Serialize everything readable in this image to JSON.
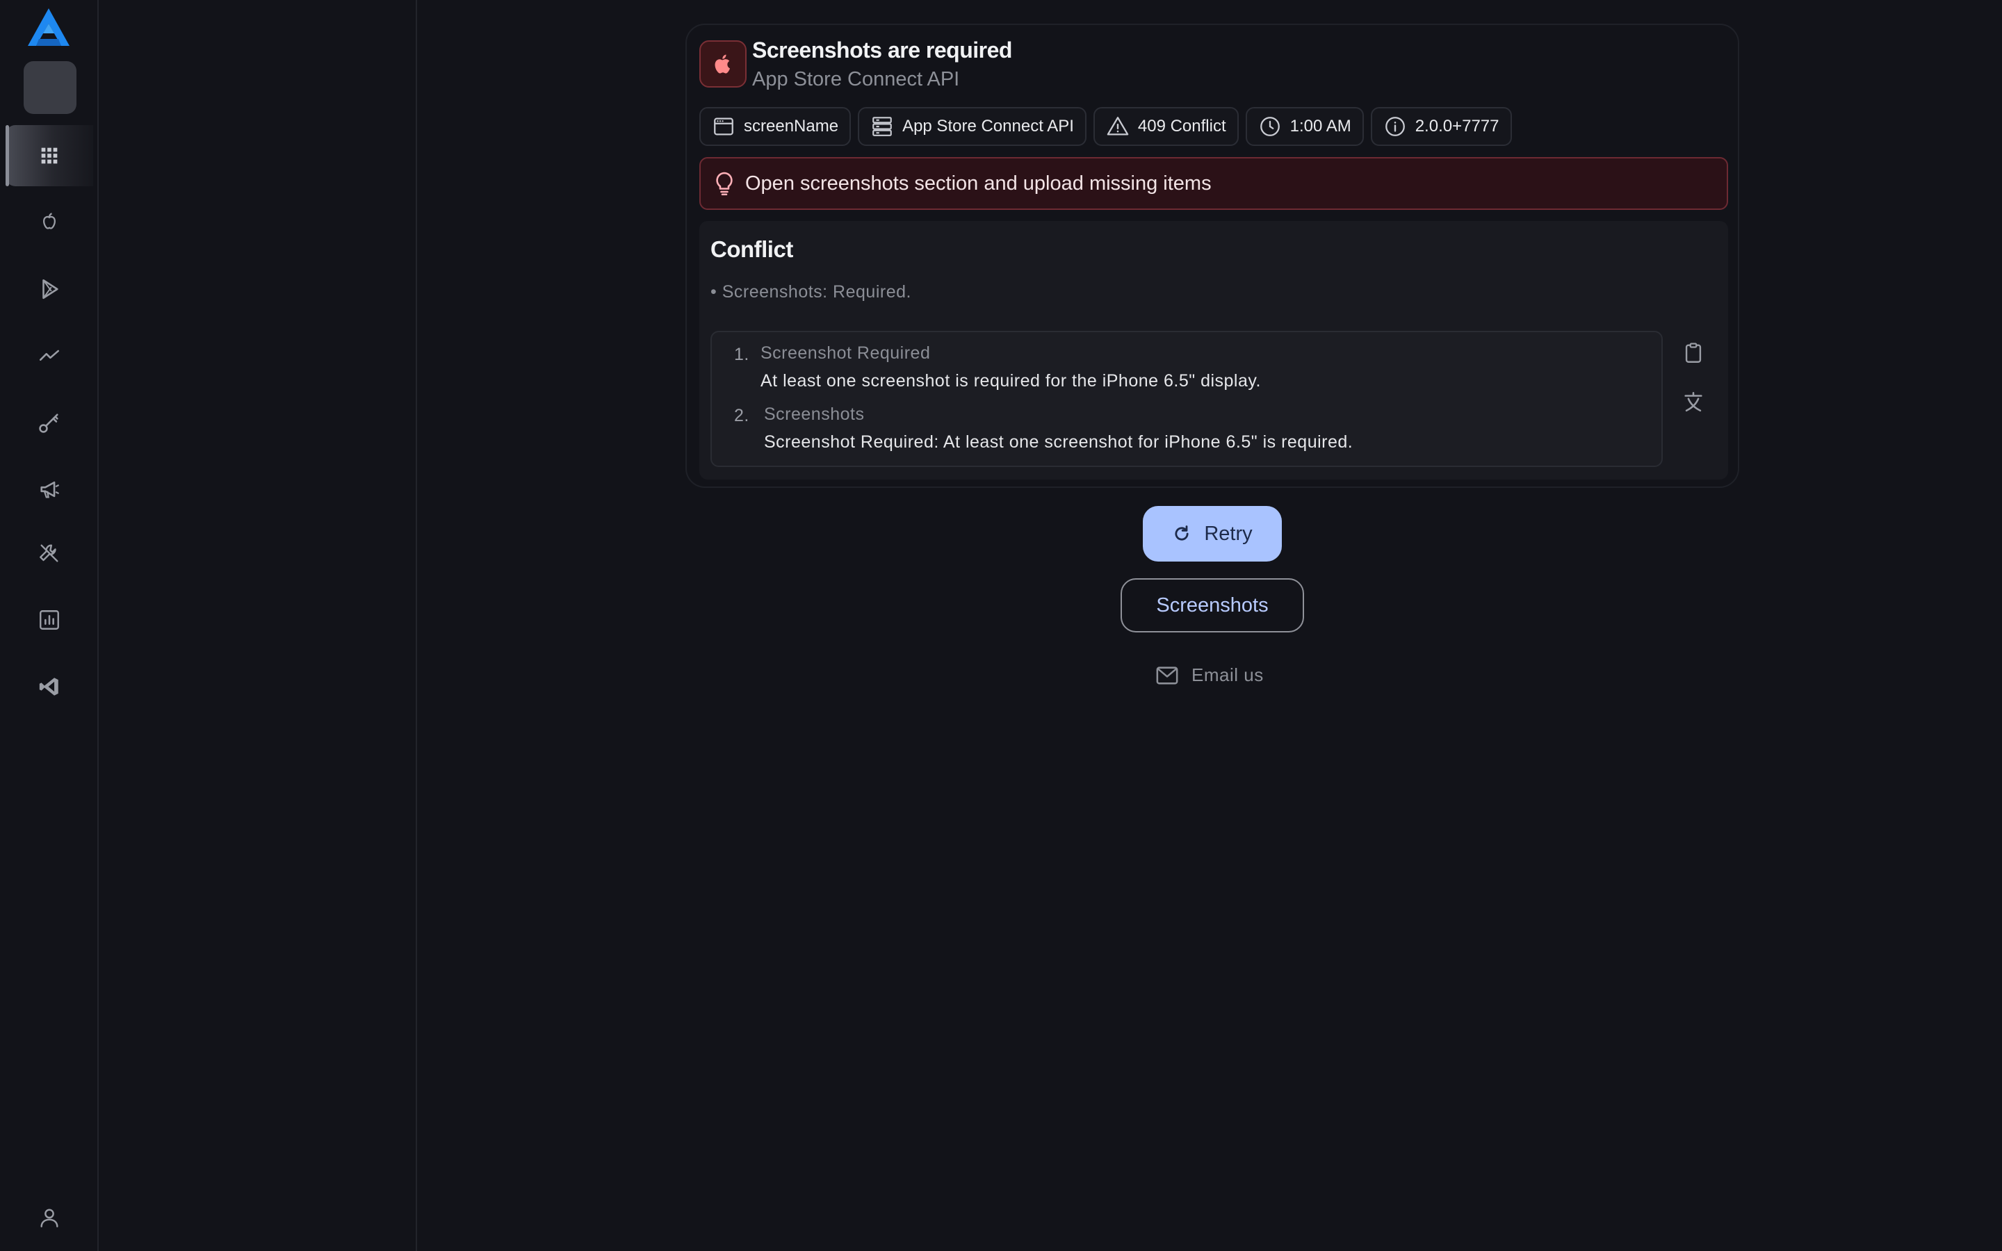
{
  "rail": {
    "items": [
      {
        "name": "grid-icon",
        "active": true
      },
      {
        "name": "apple-icon"
      },
      {
        "name": "play-store-icon"
      },
      {
        "name": "trend-icon"
      },
      {
        "name": "key-icon"
      },
      {
        "name": "megaphone-icon"
      },
      {
        "name": "tools-icon"
      },
      {
        "name": "analytics-icon"
      },
      {
        "name": "vscode-icon"
      }
    ],
    "bottom_icon": "user-icon"
  },
  "error": {
    "title": "Screenshots are required",
    "subtitle": "App Store Connect API",
    "chips": [
      {
        "icon": "window-icon",
        "label": "screenName"
      },
      {
        "icon": "server-icon",
        "label": "App Store Connect API"
      },
      {
        "icon": "warning-icon",
        "label": "409 Conflict"
      },
      {
        "icon": "clock-icon",
        "label": "1:00 AM"
      },
      {
        "icon": "info-icon",
        "label": "2.0.0+7777"
      }
    ],
    "hint": "Open screenshots section and upload missing items",
    "conflict_heading": "Conflict",
    "bullet": "• Screenshots: Required.",
    "details": [
      {
        "num": "1.",
        "head": "Screenshot Required",
        "body": "At least one screenshot is required for the iPhone 6.5\" display."
      },
      {
        "num": "2.",
        "head": "Screenshots",
        "body": "Screenshot Required: At least one screenshot for iPhone 6.5\" is required."
      }
    ]
  },
  "actions": {
    "retry": "Retry",
    "screenshots": "Screenshots",
    "email": "Email us"
  },
  "colors": {
    "background": "#121319",
    "accent": "#a9c3ff",
    "error_bg": "#2b1117",
    "error_border": "#6d2a33"
  }
}
